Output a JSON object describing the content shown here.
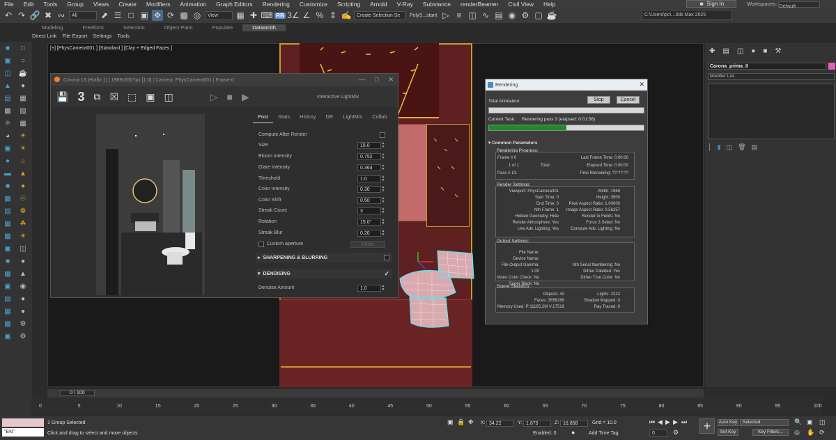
{
  "menu": [
    "File",
    "Edit",
    "Tools",
    "Group",
    "Views",
    "Create",
    "Modifiers",
    "Animation",
    "Graph Editors",
    "Rendering",
    "Customize",
    "Scripting",
    "Arnold",
    "V-Ray",
    "Substance",
    "renderBeamer",
    "Civil View",
    "Help"
  ],
  "signin": "Sign In",
  "workspace_label": "Workspaces:",
  "workspace_value": "Default",
  "toolbar": {
    "filter": "All",
    "view": "View",
    "selection_set": "Create Selection Se",
    "polys": "PolyS...stant",
    "path": "C:\\Users\\pc\\...3ds Max 2025"
  },
  "ribbon_tabs": [
    "Modeling",
    "Freeform",
    "Selection",
    "Object Paint",
    "Populate",
    "Datasmith"
  ],
  "ribbon_sub": [
    "Direct Link",
    "File Export",
    "Settings",
    "Tools"
  ],
  "viewport_label": "[+] [PhysCamera001 ] [Standard ] [Clay + Edged Faces ]",
  "corona": {
    "title": "Corona 13 (Hotfix 1) | 1969x3507px [1:0] | Camera: PhysCamera001 | Frame 0",
    "number": "3",
    "lightmix": "Interactive LightMix",
    "tabs": [
      "Post",
      "Stats",
      "History",
      "DR",
      "LightMix",
      "Collab"
    ],
    "compute_after": "Compute After Render",
    "params": [
      {
        "label": "Size",
        "value": "15.0"
      },
      {
        "label": "Bloom Intensity",
        "value": "0.752"
      },
      {
        "label": "Glare Intensity",
        "value": "0.364"
      },
      {
        "label": "Threshold",
        "value": "1.0"
      },
      {
        "label": "Color Intensity",
        "value": "0.30"
      },
      {
        "label": "Color Shift",
        "value": "0.50"
      },
      {
        "label": "Streak Count",
        "value": "3"
      },
      {
        "label": "Rotation",
        "value": "15.0°"
      },
      {
        "label": "Streak Blur",
        "value": "0.20"
      }
    ],
    "custom_aperture": "Custom aperture",
    "editor": "Editor",
    "sharpening": "SHARPENING & BLURRING",
    "denoising": "DENOISING",
    "denoise_label": "Denoise Amount",
    "denoise_value": "1.0"
  },
  "rendering": {
    "title": "Rendering",
    "stop": "Stop",
    "cancel": "Cancel",
    "total_animation": "Total Animation:",
    "current_task_label": "Current Task:",
    "current_task": "Rendering pass 3 (elapsed: 0:01:56)",
    "progress": 0.5,
    "common": "Common Parameters",
    "rp_title": "Rendering Progress:",
    "frame": "Frame #   0",
    "one_of": "1 of 1",
    "total": "Total",
    "pass": "Pass #   1/1",
    "last_frame": "Last Frame Time:   0:00:00",
    "elapsed": "Elapsed Time:   0:00:00",
    "remaining": "Time Remaining:   ??:??:??",
    "rs_title": "Render Settings:",
    "settings_left": [
      "Viewport: PhysCamera001",
      "Start Time: 0",
      "End Time: 0",
      "Nth Frame: 1",
      "Hidden Geometry: Hide",
      "Render Atmosphere: Yes",
      "Use Adv. Lighting: Yes"
    ],
    "settings_right": [
      "Width: 1969",
      "Height: 3500",
      "Pixel Aspect Ratio: 1.00000",
      "Image Aspect Ratio: 0.56257",
      "Render to Fields: No",
      "Force 2-Sided: No",
      "Compute Adv. Lighting: No"
    ],
    "os_title": "Output Settings:",
    "output_left": [
      "File Name:",
      "Device Name:",
      "File Output Gamma: 1.00",
      "Video Color Check: No",
      "Super Black: No"
    ],
    "output_right": [
      "Nth Serial Numbering: No",
      "Dither Paletted: Yes",
      "Dither True Color: No"
    ],
    "ss_title": "Scene Statistics:",
    "stats_left": [
      "Objects: 43",
      "Faces: 3656289",
      "Memory Used: P:11165.2M V:17519"
    ],
    "stats_right": [
      "Lights: 2222",
      "Shadow Mapped: 0",
      "Ray Traced: 0"
    ]
  },
  "cmdpanel": {
    "object_name": "Carona_prima_II",
    "modifier_list": "Modifier List"
  },
  "timeline": {
    "slider": "0 / 100",
    "ticks": [
      "0",
      "5",
      "10",
      "15",
      "20",
      "25",
      "30",
      "35",
      "40",
      "45",
      "50",
      "55",
      "60",
      "65",
      "70",
      "75",
      "80",
      "85",
      "90",
      "95",
      "100"
    ]
  },
  "status": {
    "group_selected": "1 Group Selected",
    "prompt": "Click and drag to select and move objects",
    "en": "\"EN\"",
    "x_label": "X:",
    "x": "34.22",
    "y_label": "Y:",
    "y": "1.875",
    "z_label": "Z:",
    "z": "16.858",
    "grid": "Grid = 10.0",
    "enabled": "Enabled: 0",
    "add_time_tag": "Add Time Tag",
    "auto_key": "Auto Key",
    "selected": "Selected",
    "set_key": "Set Key",
    "key_filters": "Key Filters...",
    "frame_field": "0"
  }
}
